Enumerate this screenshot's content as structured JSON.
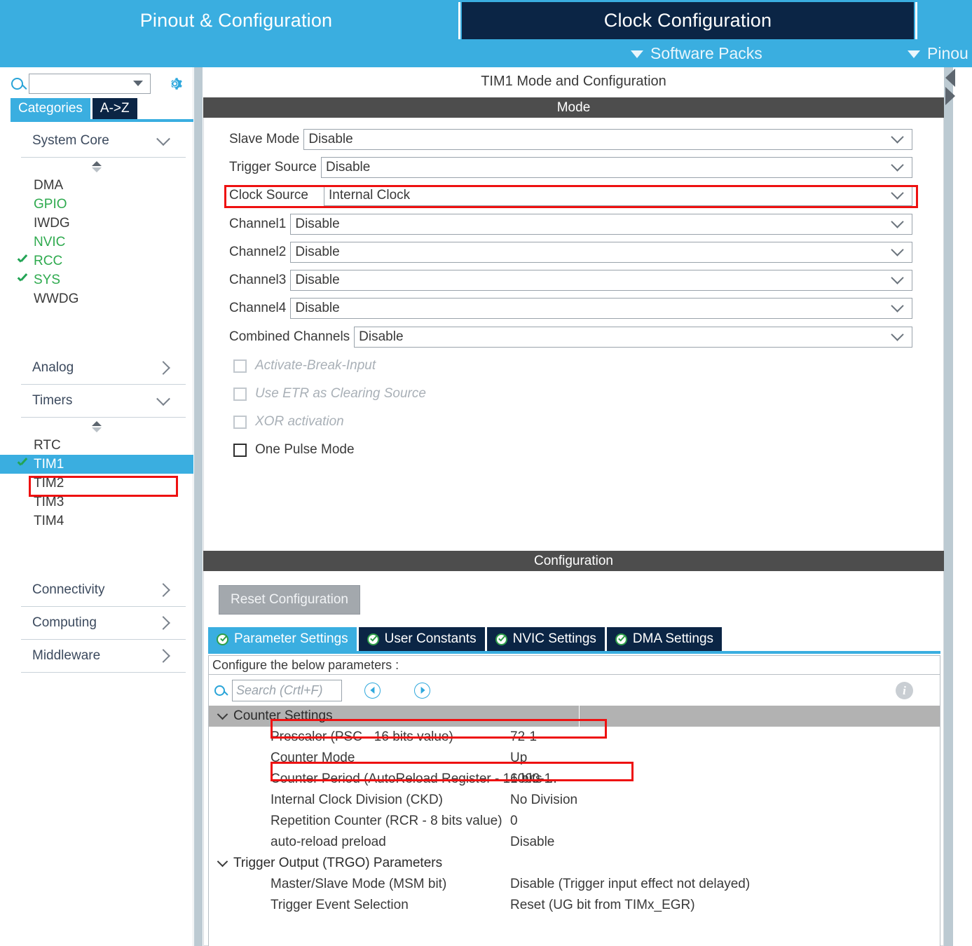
{
  "topnav": {
    "tabs": [
      {
        "label": "Pinout & Configuration",
        "active": false
      },
      {
        "label": "Clock Configuration",
        "active": true
      },
      {
        "label": "",
        "active": false
      }
    ],
    "subitems": [
      {
        "label": "Software Packs"
      },
      {
        "label": "Pinou"
      }
    ]
  },
  "sidebar": {
    "search_value": "",
    "gear_icon": "gear-icon",
    "tabs": [
      {
        "label": "Categories",
        "active": true
      },
      {
        "label": "A->Z",
        "active": false
      }
    ],
    "groups": [
      {
        "title": "System Core",
        "expanded": true,
        "items": [
          {
            "label": "DMA",
            "state": "normal"
          },
          {
            "label": "GPIO",
            "state": "configured"
          },
          {
            "label": "IWDG",
            "state": "normal"
          },
          {
            "label": "NVIC",
            "state": "configured"
          },
          {
            "label": "RCC",
            "state": "checked"
          },
          {
            "label": "SYS",
            "state": "checked"
          },
          {
            "label": "WWDG",
            "state": "normal"
          }
        ]
      },
      {
        "title": "Analog",
        "expanded": false,
        "items": []
      },
      {
        "title": "Timers",
        "expanded": true,
        "items": [
          {
            "label": "RTC",
            "state": "normal"
          },
          {
            "label": "TIM1",
            "state": "selected"
          },
          {
            "label": "TIM2",
            "state": "normal"
          },
          {
            "label": "TIM3",
            "state": "normal"
          },
          {
            "label": "TIM4",
            "state": "normal"
          }
        ]
      },
      {
        "title": "Connectivity",
        "expanded": false,
        "items": []
      },
      {
        "title": "Computing",
        "expanded": false,
        "items": []
      },
      {
        "title": "Middleware",
        "expanded": false,
        "items": []
      }
    ]
  },
  "main": {
    "panel_title": "TIM1 Mode and Configuration",
    "mode_band": "Mode",
    "mode_rows": [
      {
        "label": "Slave Mode",
        "value": "Disable",
        "highlight": false
      },
      {
        "label": "Trigger Source",
        "value": "Disable",
        "highlight": false
      },
      {
        "label": "Clock Source",
        "value": "Internal Clock",
        "highlight": true
      },
      {
        "label": "Channel1",
        "value": "Disable",
        "highlight": false
      },
      {
        "label": "Channel2",
        "value": "Disable",
        "highlight": false
      },
      {
        "label": "Channel3",
        "value": "Disable",
        "highlight": false
      },
      {
        "label": "Channel4",
        "value": "Disable",
        "highlight": false
      },
      {
        "label": "Combined Channels",
        "value": "Disable",
        "highlight": false
      }
    ],
    "checkboxes": [
      {
        "label": "Activate-Break-Input",
        "checked": false,
        "disabled": true
      },
      {
        "label": "Use ETR as Clearing Source",
        "checked": false,
        "disabled": true
      },
      {
        "label": "XOR activation",
        "checked": false,
        "disabled": true
      },
      {
        "label": "One Pulse Mode",
        "checked": false,
        "disabled": false
      }
    ],
    "config_band": "Configuration",
    "reset_button": "Reset Configuration",
    "config_tabs": [
      {
        "label": "Parameter Settings",
        "active": true
      },
      {
        "label": "User Constants",
        "active": false
      },
      {
        "label": "NVIC Settings",
        "active": false
      },
      {
        "label": "DMA Settings",
        "active": false
      }
    ],
    "configure_hint": "Configure the below parameters :",
    "search_placeholder": "Search (Crtl+F)",
    "search_value": "",
    "prev_label": "previous-match",
    "next_label": "next-match",
    "info_label": "i",
    "param_groups": [
      {
        "title": "Counter Settings",
        "shaded": true,
        "rows": [
          {
            "name": "Prescaler (PSC - 16 bits value)",
            "value": "72-1",
            "highlight": true
          },
          {
            "name": "Counter Mode",
            "value": "Up",
            "highlight": false
          },
          {
            "name": "Counter Period (AutoReload Register - 16 bits ...",
            "value": "1000-1",
            "highlight": true
          },
          {
            "name": "Internal Clock Division (CKD)",
            "value": "No Division",
            "highlight": false
          },
          {
            "name": "Repetition Counter (RCR - 8 bits value)",
            "value": "0",
            "highlight": false
          },
          {
            "name": "auto-reload preload",
            "value": "Disable",
            "highlight": false
          }
        ]
      },
      {
        "title": "Trigger Output (TRGO) Parameters",
        "shaded": false,
        "rows": [
          {
            "name": "Master/Slave Mode (MSM bit)",
            "value": "Disable (Trigger input effect not delayed)",
            "highlight": false
          },
          {
            "name": "Trigger Event Selection",
            "value": "Reset (UG bit from TIMx_EGR)",
            "highlight": false
          }
        ]
      }
    ]
  },
  "colors": {
    "accent_blue": "#3aaee0",
    "dark_navy": "#0b2545",
    "band_gray": "#4d4d4d",
    "green_check": "#2eaa4e",
    "annotation_red": "#ee1111",
    "splitter": "#bccad2"
  }
}
